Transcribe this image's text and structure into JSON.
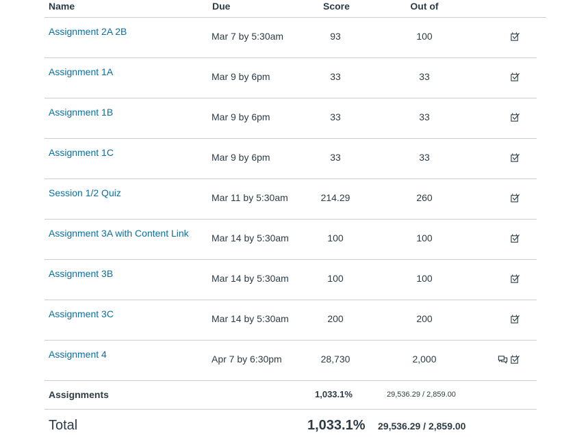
{
  "header": {
    "name": "Name",
    "due": "Due",
    "score": "Score",
    "out_of": "Out of"
  },
  "rows": [
    {
      "name": "Assignment 2A 2B",
      "due": "Mar 7 by 5:30am",
      "score": "93",
      "out_of": "100",
      "icons": [
        "rubric-icon"
      ]
    },
    {
      "name": "Assignment 1A",
      "due": "Mar 9 by 6pm",
      "score": "33",
      "out_of": "33",
      "icons": [
        "rubric-icon"
      ]
    },
    {
      "name": "Assignment 1B",
      "due": "Mar 9 by 6pm",
      "score": "33",
      "out_of": "33",
      "icons": [
        "rubric-icon"
      ]
    },
    {
      "name": "Assignment 1C",
      "due": "Mar 9 by 6pm",
      "score": "33",
      "out_of": "33",
      "icons": [
        "rubric-icon"
      ]
    },
    {
      "name": "Session 1/2 Quiz",
      "due": "Mar 11 by 5:30am",
      "score": "214.29",
      "out_of": "260",
      "icons": [
        "rubric-icon"
      ]
    },
    {
      "name": "Assignment 3A with Content Link",
      "due": "Mar 14 by 5:30am",
      "score": "100",
      "out_of": "100",
      "icons": [
        "rubric-icon"
      ]
    },
    {
      "name": "Assignment 3B",
      "due": "Mar 14 by 5:30am",
      "score": "100",
      "out_of": "100",
      "icons": [
        "rubric-icon"
      ]
    },
    {
      "name": "Assignment 3C",
      "due": "Mar 14 by 5:30am",
      "score": "200",
      "out_of": "200",
      "icons": [
        "rubric-icon"
      ]
    },
    {
      "name": "Assignment 4",
      "due": "Apr 7 by 6:30pm",
      "score": "28,730",
      "out_of": "2,000",
      "icons": [
        "comments-icon",
        "rubric-icon"
      ]
    }
  ],
  "summary": {
    "label": "Assignments",
    "percent": "1,033.1%",
    "points": "29,536.29 / 2,859.00"
  },
  "total": {
    "label": "Total",
    "percent": "1,033.1%",
    "points": "29,536.29 / 2,859.00"
  },
  "colors": {
    "link": "#0770a3",
    "text": "#2d3b45",
    "border": "#c7cdd1"
  }
}
